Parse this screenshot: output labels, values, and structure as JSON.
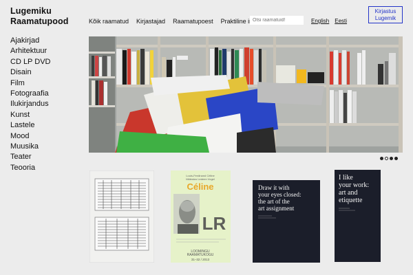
{
  "brand": {
    "line1": "Lugemiku",
    "line2": "Raamatupood"
  },
  "topnav": [
    "Kõik raamatud",
    "Kirjastajad",
    "Raamatupoest",
    "Praktiline info"
  ],
  "search": {
    "placeholder": "Otsi raamatuid!"
  },
  "languages": [
    "English",
    "Eesti"
  ],
  "login": {
    "line1": "Kirjastus",
    "line2": "Lugemik"
  },
  "categories": [
    "Ajakirjad",
    "Arhitektuur",
    "CD LP DVD",
    "Disain",
    "Film",
    "Fotograafia",
    "Ilukirjandus",
    "Kunst",
    "Lastele",
    "Mood",
    "Muusika",
    "Teater",
    "Teooria"
  ],
  "carousel": {
    "count": 4,
    "active": 1
  },
  "books": [
    {
      "cover_text": []
    },
    {
      "cover_text": [
        "Louis-Ferdinand Céline",
        "Mälestus Ledeen Vogel",
        "Céline",
        "LR",
        "LOOMINGU",
        "RAAMATUKOGU",
        "31–32 / 2013"
      ]
    },
    {
      "cover_text": [
        "Draw it with",
        "your eyes closed:",
        "the art of the",
        "art assignment"
      ]
    },
    {
      "cover_text": [
        "I like",
        "your work:",
        "art and",
        "etiquette"
      ]
    }
  ],
  "colors": {
    "accent": "#2233c8",
    "background": "#ececec"
  }
}
